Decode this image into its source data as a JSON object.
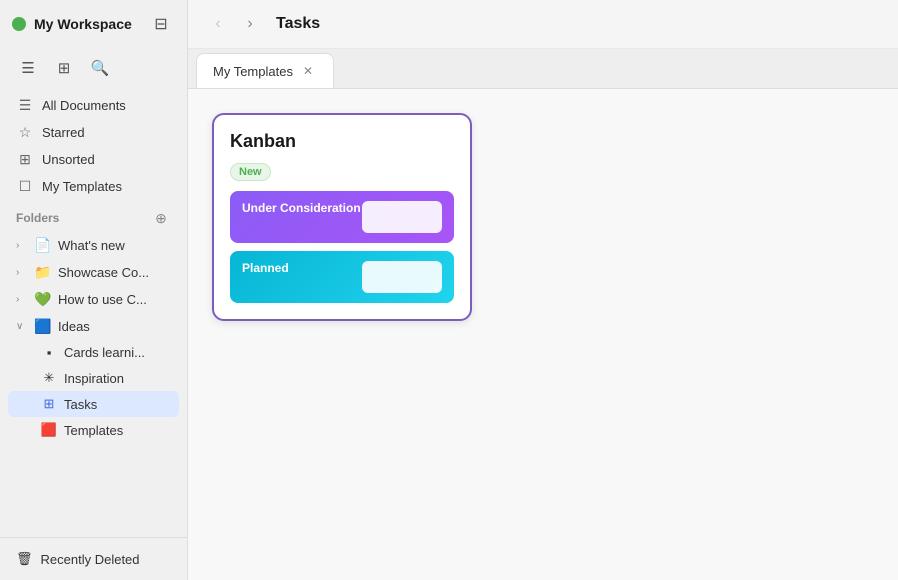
{
  "sidebar": {
    "workspace_name": "My Workspace",
    "nav_items": [
      {
        "label": "All Documents",
        "icon": "☰"
      },
      {
        "label": "Starred",
        "icon": "☆"
      },
      {
        "label": "Unsorted",
        "icon": "⊞"
      },
      {
        "label": "My Templates",
        "icon": "☐"
      }
    ],
    "folders_label": "Folders",
    "folders": [
      {
        "label": "What's new",
        "icon": "📄",
        "chevron": "›",
        "color": "#555"
      },
      {
        "label": "Showcase Co...",
        "icon": "📁",
        "chevron": "›",
        "color": "#555"
      },
      {
        "label": "How to use C...",
        "icon": "💚",
        "chevron": "›",
        "color": "#4CAF50"
      },
      {
        "label": "Ideas",
        "icon": "🟦",
        "chevron": "∨",
        "color": "#4169e1",
        "expanded": true
      }
    ],
    "sub_items": [
      {
        "label": "Cards learni...",
        "icon": "▪"
      },
      {
        "label": "Inspiration",
        "icon": "✳"
      },
      {
        "label": "Tasks",
        "icon": "⊞",
        "active": true
      },
      {
        "label": "Templates",
        "icon": "🟥"
      }
    ],
    "recently_deleted": "Recently Deleted"
  },
  "header": {
    "title": "Tasks",
    "back_disabled": true,
    "forward_disabled": false
  },
  "tabs": [
    {
      "label": "My Templates",
      "active": true
    }
  ],
  "kanban": {
    "title": "Kanban",
    "badge": "New",
    "lanes": [
      {
        "label": "Under Consideration",
        "color": "purple"
      },
      {
        "label": "Planned",
        "color": "cyan"
      }
    ]
  }
}
